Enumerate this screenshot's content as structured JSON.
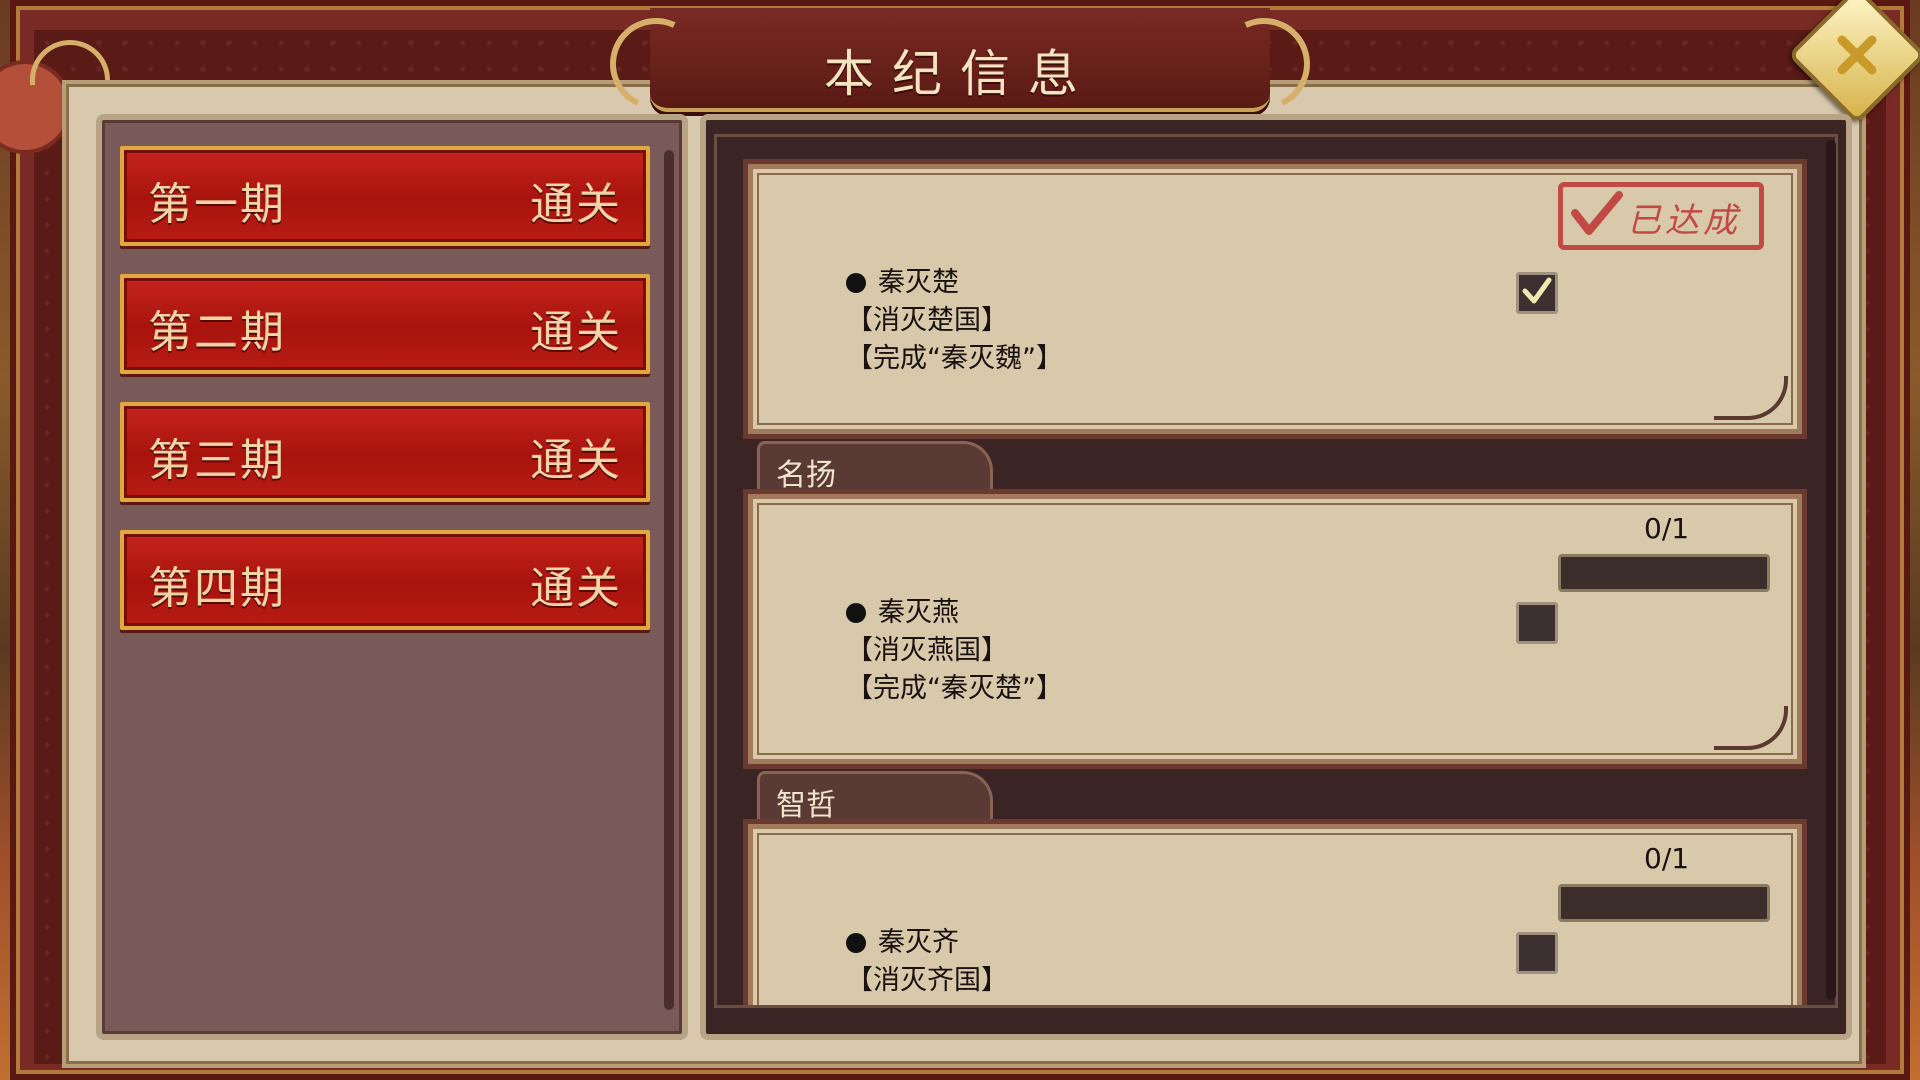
{
  "title": "本纪信息",
  "periods": [
    {
      "name": "第一期",
      "status": "通关"
    },
    {
      "name": "第二期",
      "status": "通关"
    },
    {
      "name": "第三期",
      "status": "通关"
    },
    {
      "name": "第四期",
      "status": "通关"
    }
  ],
  "achievements": [
    {
      "category": "",
      "name": "秦灭楚",
      "desc": "【消灭楚国】",
      "req": "【完成“秦灭魏”】",
      "checked": true,
      "stamp": "已达成"
    },
    {
      "category": "名扬",
      "name": "秦灭燕",
      "desc": "【消灭燕国】",
      "req": "【完成“秦灭楚”】",
      "checked": false,
      "progress": "0/1",
      "progress_fraction": 0
    },
    {
      "category": "智哲",
      "name": "秦灭齐",
      "desc": "【消灭齐国】",
      "req": "",
      "checked": false,
      "progress": "0/1",
      "progress_fraction": 0
    }
  ],
  "colors": {
    "period_button": "#b81c14",
    "period_border": "#e1a840",
    "stamp": "#c24a44",
    "card_bg": "#d8c9ab"
  },
  "icons": {
    "close": "close-icon",
    "check": "check-icon",
    "stamp": "achieved-stamp"
  }
}
